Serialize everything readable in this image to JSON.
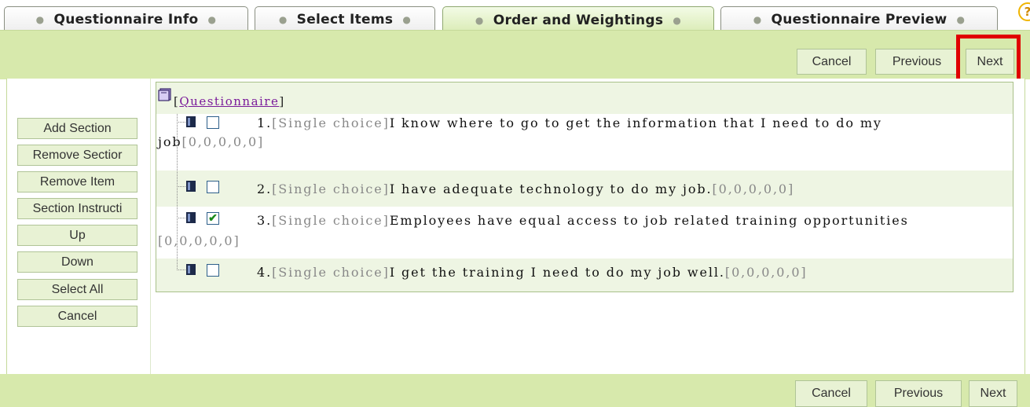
{
  "tabs": [
    {
      "label": "Questionnaire Info",
      "active": false
    },
    {
      "label": "Select Items",
      "active": false
    },
    {
      "label": "Order and Weightings",
      "active": true
    },
    {
      "label": "Questionnaire Preview",
      "active": false
    }
  ],
  "help_icon": "help-icon",
  "toolbar_top": {
    "cancel": "Cancel",
    "previous": "Previous",
    "next": "Next"
  },
  "toolbar_bottom": {
    "cancel": "Cancel",
    "previous": "Previous",
    "next": "Next"
  },
  "sidebar": {
    "items": [
      {
        "label": "Add Section"
      },
      {
        "label": "Remove Sectior"
      },
      {
        "label": "Remove Item"
      },
      {
        "label": "Section Instructi"
      },
      {
        "label": "Up"
      },
      {
        "label": "Down"
      },
      {
        "label": "Select All"
      },
      {
        "label": "Cancel"
      }
    ]
  },
  "tree": {
    "root_open": "[",
    "root_label": "Questionnaire",
    "root_close": "]",
    "items": [
      {
        "number": "1.",
        "type": "[Single choice]",
        "text": "I know where to go to get the information that I need to do my",
        "text_cont": "job",
        "weights": "[0,0,0,0,0]",
        "checked": false
      },
      {
        "number": "2.",
        "type": "[Single choice]",
        "text": "I have adequate technology to do my job.",
        "weights": "[0,0,0,0,0]",
        "checked": false
      },
      {
        "number": "3.",
        "type": "[Single choice]",
        "text": "Employees have equal access to job related training opportunities",
        "weights": "[0,0,0,0,0]",
        "checked": true
      },
      {
        "number": "4.",
        "type": "[Single choice]",
        "text": "I get the training I need to do my job well.",
        "weights": "[0,0,0,0,0]",
        "checked": false
      }
    ]
  },
  "colors": {
    "toolbar_green": "#d7e9ac",
    "row_alt": "#eef5e3",
    "highlight_red": "#e00000",
    "link_purple": "#7a1a9a"
  }
}
